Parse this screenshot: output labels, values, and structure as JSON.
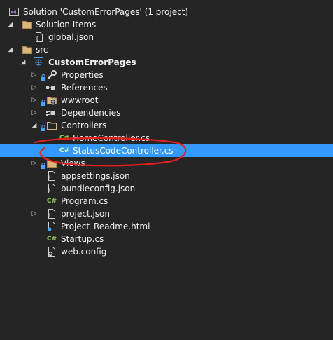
{
  "solution_explorer": {
    "items": [
      {
        "label": "Solution 'CustomErrorPages' (1 project)",
        "icon": "visual-studio-solution-icon",
        "expander": "none"
      },
      {
        "label": "Solution Items",
        "icon": "folder-icon",
        "expander": "expanded"
      },
      {
        "label": "global.json",
        "icon": "json-file-icon",
        "expander": "none"
      },
      {
        "label": "src",
        "icon": "folder-icon",
        "expander": "expanded"
      },
      {
        "label": "CustomErrorPages",
        "icon": "web-project-icon",
        "expander": "expanded"
      },
      {
        "label": "Properties",
        "icon": "wrench-icon",
        "expander": "collapsed"
      },
      {
        "label": "References",
        "icon": "references-icon",
        "expander": "collapsed"
      },
      {
        "label": "wwwroot",
        "icon": "globe-folder-icon",
        "expander": "collapsed"
      },
      {
        "label": "Dependencies",
        "icon": "dependencies-icon",
        "expander": "collapsed"
      },
      {
        "label": "Controllers",
        "icon": "folder-icon",
        "expander": "expanded"
      },
      {
        "label": "HomeController.cs",
        "icon": "csharp-file-icon",
        "expander": "none"
      },
      {
        "label": "StatusCodeController.cs",
        "icon": "csharp-file-icon",
        "expander": "none",
        "selected": true
      },
      {
        "label": "Views",
        "icon": "folder-icon",
        "expander": "collapsed"
      },
      {
        "label": "appsettings.json",
        "icon": "json-file-icon",
        "expander": "none"
      },
      {
        "label": "bundleconfig.json",
        "icon": "json-file-icon",
        "expander": "none"
      },
      {
        "label": "Program.cs",
        "icon": "csharp-file-icon",
        "expander": "none"
      },
      {
        "label": "project.json",
        "icon": "json-file-icon",
        "expander": "collapsed"
      },
      {
        "label": "Project_Readme.html",
        "icon": "html-file-icon",
        "expander": "none"
      },
      {
        "label": "Startup.cs",
        "icon": "csharp-file-icon",
        "expander": "none"
      },
      {
        "label": "web.config",
        "icon": "config-file-icon",
        "expander": "none"
      }
    ]
  },
  "icon_glyphs": {
    "csharp": "C#"
  },
  "colors": {
    "background": "#252526",
    "selection": "#3399ff",
    "folder": "#dcb67a",
    "csharp": "#8cc652",
    "vs_purple": "#9b7bd1",
    "annotation_red": "#e81e1e"
  }
}
